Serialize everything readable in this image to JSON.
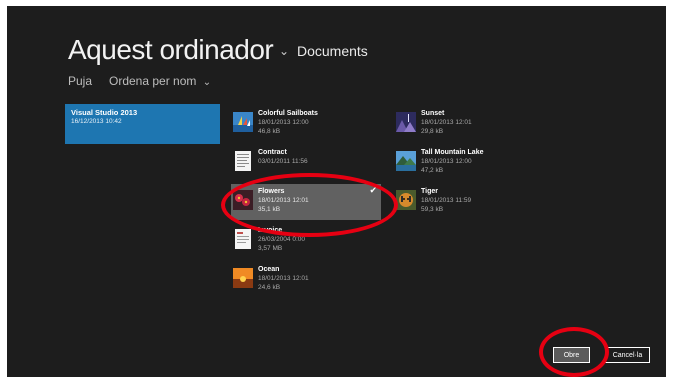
{
  "header": {
    "title": "Aquest ordinador",
    "title_chevron": "⌄",
    "location": "Documents"
  },
  "commands": {
    "up": "Puja",
    "sort": "Ordena per nom",
    "sort_chevron": "⌄"
  },
  "folders": [
    {
      "name": "Visual Studio 2013",
      "date": "16/12/2013 10:42"
    }
  ],
  "files": [
    {
      "name": "Colorful Sailboats",
      "date": "18/01/2013 12:00",
      "size": "46,8 kB",
      "icon": "sailboats-thumbnail"
    },
    {
      "name": "Contract",
      "date": "03/01/2011 11:56",
      "size": "",
      "icon": "document-thumbnail"
    },
    {
      "name": "Flowers",
      "date": "18/01/2013 12:01",
      "size": "35,1 kB",
      "icon": "flowers-thumbnail",
      "selected": true
    },
    {
      "name": "Invoice",
      "date": "26/03/2004 0:00",
      "size": "3,57 MB",
      "icon": "document-thumbnail"
    },
    {
      "name": "Ocean",
      "date": "18/01/2013 12:01",
      "size": "24,6 kB",
      "icon": "ocean-thumbnail"
    },
    {
      "name": "Sunset",
      "date": "18/01/2013 12:01",
      "size": "29,8 kB",
      "icon": "sunset-thumbnail"
    },
    {
      "name": "Tall Mountain Lake",
      "date": "18/01/2013 12:00",
      "size": "47,2 kB",
      "icon": "lake-thumbnail"
    },
    {
      "name": "Tiger",
      "date": "18/01/2013 11:59",
      "size": "59,3 kB",
      "icon": "tiger-thumbnail"
    }
  ],
  "buttons": {
    "open": "Obre",
    "cancel": "Cancel·la"
  },
  "colors": {
    "background": "#1d1d1d",
    "folder_tile": "#1e76b1",
    "selection": "#616161",
    "annotation": "#e60012"
  },
  "check_glyph": "✔"
}
